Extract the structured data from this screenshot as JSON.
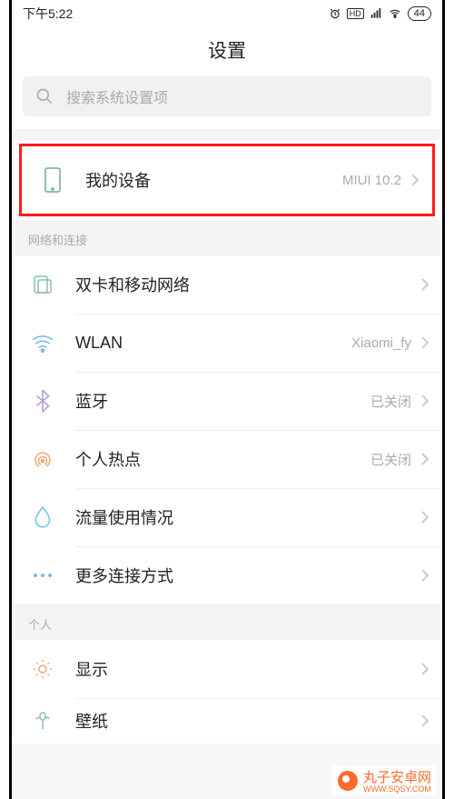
{
  "status": {
    "time": "下午5:22",
    "battery": "44"
  },
  "page": {
    "title": "设置"
  },
  "search": {
    "placeholder": "搜索系统设置项"
  },
  "sections": {
    "my_device": {
      "label": "我的设备",
      "value": "MIUI 10.2"
    },
    "network_header": "网络和连接",
    "personal_header": "个人",
    "sim": {
      "label": "双卡和移动网络"
    },
    "wlan": {
      "label": "WLAN",
      "value": "Xiaomi_fy"
    },
    "bluetooth": {
      "label": "蓝牙",
      "value": "已关闭"
    },
    "hotspot": {
      "label": "个人热点",
      "value": "已关闭"
    },
    "data_usage": {
      "label": "流量使用情况"
    },
    "more_conn": {
      "label": "更多连接方式"
    },
    "display": {
      "label": "显示"
    },
    "wallpaper": {
      "label": "壁纸"
    }
  },
  "watermark": {
    "title": "丸子安卓网",
    "sub": "WWW.SQSY.COM"
  }
}
